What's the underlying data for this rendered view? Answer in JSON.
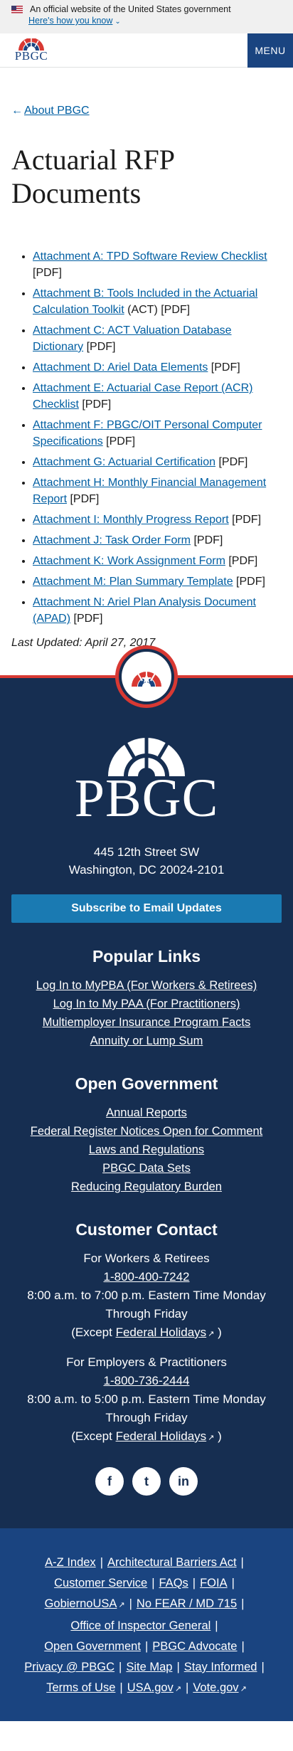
{
  "gov_banner": {
    "text": "An official website of the United States government",
    "how_link": "Here's how you know"
  },
  "header": {
    "logo_text": "PBGC",
    "menu_label": "MENU"
  },
  "main": {
    "back_link": "About PBGC",
    "title": "Actuarial RFP Documents",
    "documents": [
      {
        "link": "Attachment A: TPD Software Review Checklist",
        "suffix": "[PDF]"
      },
      {
        "link": "Attachment B: Tools Included in the Actuarial Calculation Toolkit",
        "suffix": "(ACT) [PDF]"
      },
      {
        "link": "Attachment C: ACT Valuation Database Dictionary",
        "suffix": "[PDF]"
      },
      {
        "link": "Attachment D: Ariel Data Elements",
        "suffix": "[PDF]"
      },
      {
        "link": "Attachment E: Actuarial Case Report (ACR) Checklist",
        "suffix": "[PDF]"
      },
      {
        "link": "Attachment F: PBGC/OIT Personal Computer Specifications",
        "suffix": "[PDF]"
      },
      {
        "link": "Attachment G: Actuarial Certification",
        "suffix": "[PDF]"
      },
      {
        "link": "Attachment H: Monthly Financial Management Report",
        "suffix": "[PDF]"
      },
      {
        "link": "Attachment I: Monthly Progress Report",
        "suffix": "[PDF]"
      },
      {
        "link": "Attachment J: Task Order Form",
        "suffix": "[PDF]"
      },
      {
        "link": "Attachment K: Work Assignment Form",
        "suffix": "[PDF]"
      },
      {
        "link": "Attachment M: Plan Summary Template",
        "suffix": "[PDF]"
      },
      {
        "link": "Attachment N: Ariel Plan Analysis Document (APAD)",
        "suffix": "[PDF]"
      }
    ],
    "last_updated": "Last Updated: April 27, 2017"
  },
  "footer": {
    "logo_text": "PBGC",
    "address_line1": "445 12th Street SW",
    "address_line2": "Washington, DC 20024-2101",
    "subscribe_label": "Subscribe to Email Updates",
    "popular_heading": "Popular Links",
    "popular_links": [
      "Log In to MyPBA (For Workers & Retirees)",
      "Log In to My PAA (For Practitioners)",
      "Multiemployer Insurance Program Facts",
      "Annuity or Lump Sum"
    ],
    "open_gov_heading": "Open Government",
    "open_gov_links": [
      "Annual Reports",
      "Federal Register Notices Open for Comment",
      "Laws and Regulations",
      "PBGC Data Sets",
      "Reducing Regulatory Burden"
    ],
    "contact_heading": "Customer Contact",
    "workers": {
      "label": "For Workers & Retirees",
      "phone": "1-800-400-7242",
      "hours": "8:00 a.m. to 7:00 p.m. Eastern Time Monday Through Friday",
      "except_prefix": "(Except",
      "holidays_link": "Federal Holidays",
      "except_suffix": ")"
    },
    "employers": {
      "label": "For Employers & Practitioners",
      "phone": "1-800-736-2444",
      "hours": "8:00 a.m. to 5:00 p.m. Eastern Time Monday Through Friday",
      "except_prefix": "(Except",
      "holidays_link": "Federal Holidays",
      "except_suffix": ")"
    },
    "social": {
      "facebook": "f",
      "twitter": "t",
      "linkedin": "in"
    },
    "bottom_links": {
      "az": "A-Z Index",
      "barriers": "Architectural Barriers Act",
      "customer_service": "Customer Service",
      "faqs": "FAQs",
      "foia": "FOIA",
      "gobierno": "GobiernoUSA",
      "nofear": "No FEAR / MD 715",
      "oig": "Office of Inspector General",
      "open_gov": "Open Government",
      "advocate": "PBGC Advocate",
      "privacy": "Privacy @ PBGC",
      "sitemap": "Site Map",
      "stay": "Stay Informed",
      "terms": "Terms of Use",
      "usagov": "USA.gov",
      "vote": "Vote.gov"
    },
    "separator": "|",
    "external_icon": "↗"
  }
}
